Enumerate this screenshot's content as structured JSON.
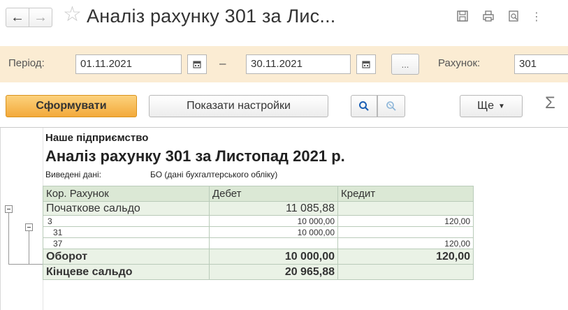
{
  "window": {
    "title": "Аналіз рахунку 301 за Лис...",
    "back_icon": "arrow-left-icon",
    "forward_icon": "arrow-right-icon",
    "favorite_icon": "star-icon"
  },
  "period": {
    "label": "Період:",
    "from": "01.11.2021",
    "dash": "–",
    "to": "30.11.2021",
    "more_label": "...",
    "account_label": "Рахунок:",
    "account_value": "301"
  },
  "toolbar": {
    "generate_label": "Сформувати",
    "settings_label": "Показати настройки",
    "more_label": "Ще",
    "sigma_label": "Σ"
  },
  "report": {
    "org": "Наше підприємство",
    "title": "Аналіз рахунку 301 за Листопад 2021 р.",
    "output_label": "Виведені дані:",
    "output_value": "БО (дані бухгалтерського обліку)",
    "headers": [
      "Кор. Рахунок",
      "Дебет",
      "Кредит"
    ],
    "rows": [
      {
        "account": "Початкове сальдо",
        "debit": "11 085,88",
        "credit": ""
      },
      {
        "account": "3",
        "debit": "10 000,00",
        "credit": "120,00"
      },
      {
        "account": "31",
        "debit": "10 000,00",
        "credit": ""
      },
      {
        "account": "37",
        "debit": "",
        "credit": "120,00"
      },
      {
        "account": "Оборот",
        "debit": "10 000,00",
        "credit": "120,00"
      },
      {
        "account": "Кінцеве сальдо",
        "debit": "20 965,88",
        "credit": ""
      }
    ]
  },
  "colors": {
    "accent": "#f3a93a",
    "period_bg": "#fbecd3",
    "table_header": "#dbe8d5"
  }
}
